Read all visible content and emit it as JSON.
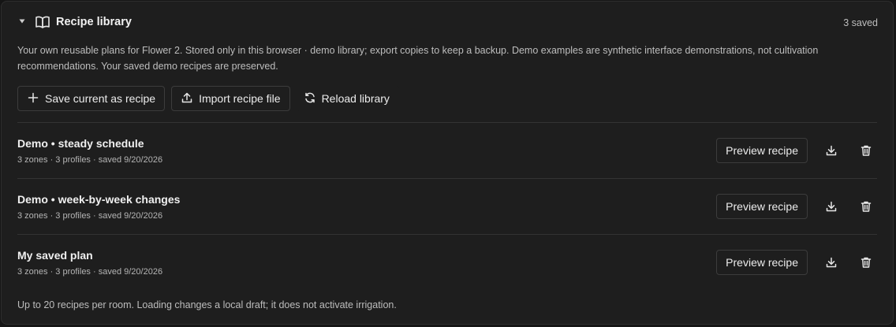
{
  "header": {
    "title": "Recipe library",
    "count": "3 saved",
    "chevron_icon": "chevron-down-icon",
    "book_icon": "book-open-icon"
  },
  "description": "Your own reusable plans for Flower 2. Stored only in this browser · demo library; export copies to keep a backup. Demo examples are synthetic interface demonstrations, not cultivation recommendations. Your saved demo recipes are preserved.",
  "actions": {
    "save_label": "Save current as recipe",
    "import_label": "Import recipe file",
    "reload_label": "Reload library"
  },
  "recipes": [
    {
      "name": "Demo • steady schedule",
      "meta": "3 zones · 3 profiles · saved 9/20/2026",
      "preview_label": "Preview recipe"
    },
    {
      "name": "Demo • week-by-week changes",
      "meta": "3 zones · 3 profiles · saved 9/20/2026",
      "preview_label": "Preview recipe"
    },
    {
      "name": "My saved plan",
      "meta": "3 zones · 3 profiles · saved 9/20/2026",
      "preview_label": "Preview recipe"
    }
  ],
  "footer": "Up to 20 recipes per room. Loading changes a local draft; it does not activate irrigation.",
  "colors": {
    "panel_bg": "#1e1e1e",
    "border": "#3c3c3c",
    "text": "#e6e6e6",
    "muted": "#bdbdbd"
  }
}
